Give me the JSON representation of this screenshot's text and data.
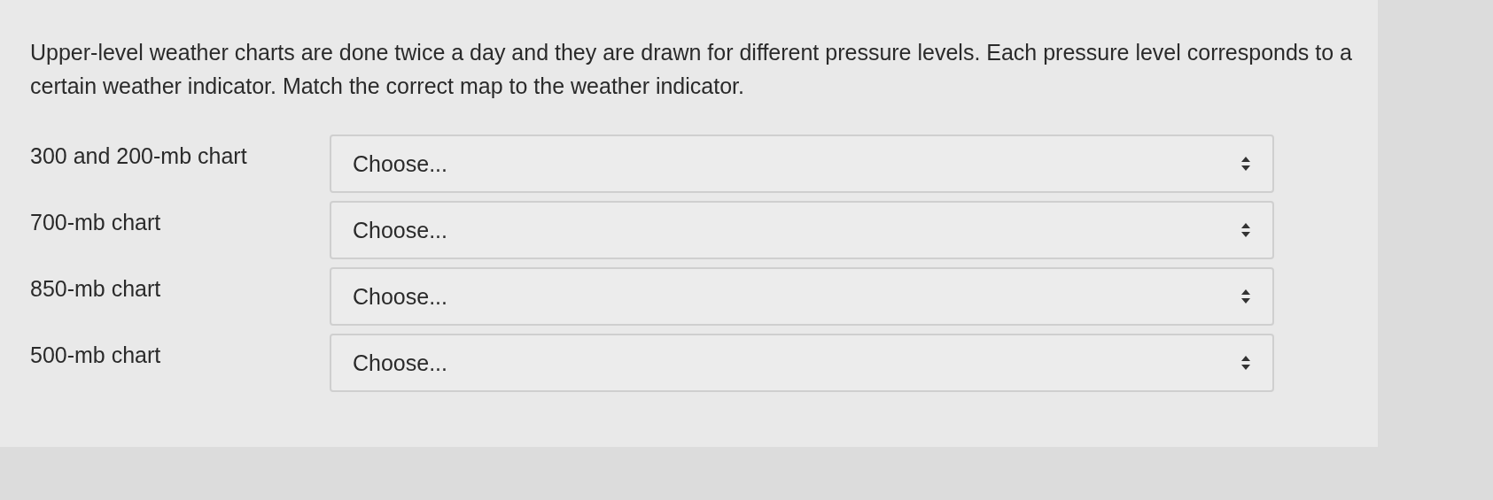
{
  "question": "Upper-level weather charts are done twice a day and they are drawn for different pressure levels.  Each pressure level corresponds to a certain weather indicator.  Match the correct map to the weather indicator.",
  "rows": [
    {
      "label": "300 and 200-mb chart",
      "value": "Choose..."
    },
    {
      "label": "700-mb chart",
      "value": "Choose..."
    },
    {
      "label": "850-mb chart",
      "value": "Choose..."
    },
    {
      "label": "500-mb chart",
      "value": "Choose..."
    }
  ]
}
